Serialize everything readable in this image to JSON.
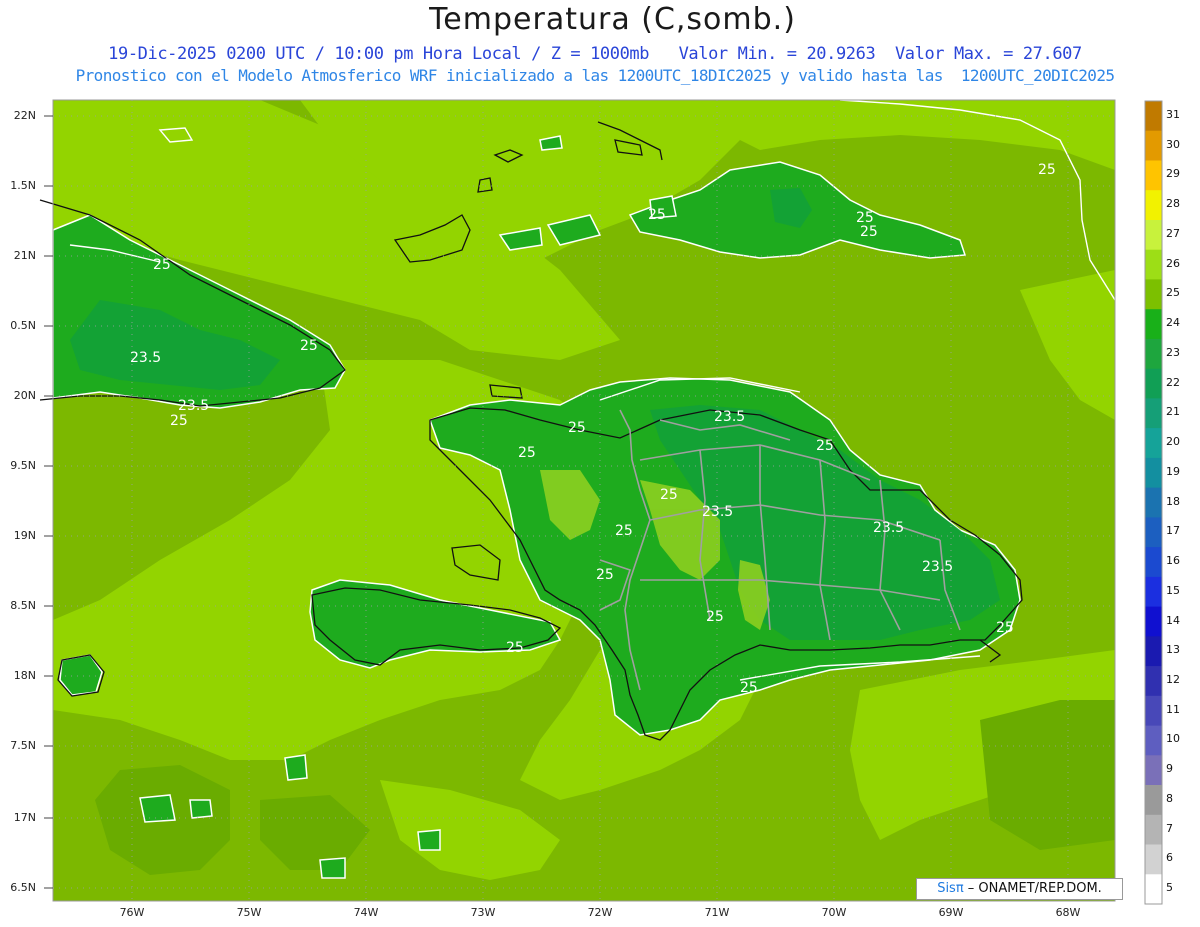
{
  "header": {
    "title": "Temperatura (C,somb.)",
    "line1": "19-Dic-2025 0200 UTC / 10:00 pm Hora Local / Z = 1000mb   Valor Min. = 20.9263  Valor Max. = 27.607",
    "line2": "Pronostico con el Modelo Atmosferico WRF inicializado a las 1200UTC_18DIC2025 y valido hasta las  1200UTC_20DIC2025"
  },
  "axes": {
    "lat_labels": [
      "22N",
      "1.5N",
      "21N",
      "0.5N",
      "20N",
      "9.5N",
      "19N",
      "8.5N",
      "18N",
      "7.5N",
      "17N",
      "6.5N"
    ],
    "lon_labels": [
      "76W",
      "75W",
      "74W",
      "73W",
      "72W",
      "71W",
      "70W",
      "69W",
      "68W"
    ]
  },
  "colorbar": {
    "labels": [
      "31",
      "30",
      "29",
      "28",
      "27",
      "26",
      "25",
      "24",
      "23",
      "22",
      "21",
      "20",
      "19",
      "18",
      "17",
      "16",
      "15",
      "14",
      "13",
      "12",
      "11",
      "10",
      "9",
      "8",
      "7",
      "6",
      "5"
    ],
    "colors": [
      "#c07a00",
      "#e39a00",
      "#ffc400",
      "#f2f200",
      "#c8f23c",
      "#9dde16",
      "#7cc000",
      "#19b019",
      "#1ea63e",
      "#119f55",
      "#159f77",
      "#15a399",
      "#138fa0",
      "#1b73b0",
      "#1c5fc0",
      "#1b4ad0",
      "#1b2fe0",
      "#1010d0",
      "#1a1ab0",
      "#3030b0",
      "#4848b8",
      "#5e5ec0",
      "#7a70b8",
      "#9a9a9a",
      "#b4b4b4",
      "#d2d2d2",
      "#ffffff"
    ]
  },
  "contour_labels": [
    "25",
    "25",
    "25",
    "25",
    "23.5",
    "25",
    "23.5",
    "25",
    "25",
    "23.5",
    "25",
    "25",
    "25",
    "23.5",
    "25",
    "23.5",
    "23.5",
    "25",
    "25",
    "25",
    "25",
    "25",
    "25"
  ],
  "credit": {
    "sis": "Sisπ",
    "rest": " – ONAMET/REP.DOM."
  }
}
